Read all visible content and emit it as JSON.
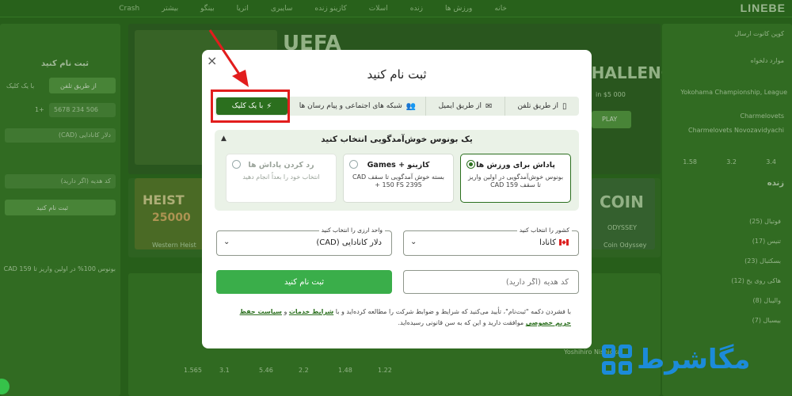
{
  "background": {
    "logo": "LINEBE",
    "topbar_items": [
      "خانه",
      "ورزش ها",
      "زنده",
      "اسلات",
      "کازینو زنده",
      "سایبری",
      "اتریا",
      "بینگو",
      "بیشتر",
      "Crash"
    ],
    "left_panel": {
      "header": "ثبت نام کنید",
      "tabs": [
        "از طریق تلفن",
        "با یک کلیک"
      ],
      "phone_prefix": "+1",
      "phone_placeholder": "506 234 5678",
      "currency": "دلار کانادایی (CAD)",
      "promo": "کد هدیه (اگر دارید)",
      "register": "ثبت نام کنید",
      "bonus_note": "بونوس 100% در اولین واریز تا 159 CAD"
    },
    "center": {
      "banner_text": "UEFA",
      "promo_text": "CHALLENGE",
      "promo_amount": "in $5 000",
      "play": "PLAY",
      "game1": "HEIST",
      "game1_amount": "25000",
      "game1_provider": "Western Heist",
      "game2": "COIN",
      "game2_sub": "ODYSSEY",
      "game2_provider": "Coin Odyssey"
    },
    "right_panel": {
      "header": "کوپن کانوت ارسال",
      "favorites": "موارد دلخواه",
      "match": "Yokohama Championship, League",
      "teams": [
        "Charmelovets",
        "Charmelovets Novozavidyachi"
      ],
      "live": "زنده",
      "odds": [
        "1.58",
        "3.2",
        "3.4"
      ],
      "sports": [
        "فوتبال (25)",
        "تنیس (17)",
        "بسکتبال (23)",
        "هاکی روی یخ (12)",
        "والیبال (8)",
        "بیسبال (7)"
      ]
    },
    "table_odds": [
      "1.565",
      "3.1",
      "5.46",
      "2.2",
      "1.48",
      "1.22"
    ],
    "table_team": "Yoshihiro Nishioka"
  },
  "modal": {
    "close": "×",
    "title": "ثبت نام کنید",
    "tabs": [
      {
        "label": "از طریق تلفن",
        "icon": "phone-icon",
        "glyph": "▯"
      },
      {
        "label": "از طریق ایمیل",
        "icon": "envelope-icon",
        "glyph": "✉"
      },
      {
        "label": "شبکه های اجتماعی و پیام رسان ها",
        "icon": "users-icon",
        "glyph": "👥"
      },
      {
        "label": "با یک کلیک",
        "icon": "lightning-icon",
        "glyph": "⚡",
        "active": true
      }
    ],
    "bonus": {
      "heading": "یک بونوس خوش‌آمدگویی انتخاب کنید",
      "options": [
        {
          "title": "پاداش برای ورزش ها",
          "desc": "بونوس خوش‌آمدگویی در اولین واریز تا سقف 159 CAD",
          "selected": true
        },
        {
          "title": "کازینو + Games",
          "desc": "بسته خوش آمدگویی تا سقف CAD + 150 FS 2395",
          "selected": false
        },
        {
          "title": "رد کردن پاداش ها",
          "desc": "انتخاب خود را بعداً انجام دهید",
          "selected": false
        }
      ]
    },
    "country": {
      "label": "کشور را انتخاب کنید",
      "value": "کانادا"
    },
    "currency": {
      "label": "واحد ارزی را انتخاب کنید",
      "value": "دلار کانادایی (CAD)"
    },
    "promo_placeholder": "کد هدیه (اگر دارید)",
    "submit": "ثبت نام کنید",
    "legal": {
      "before": "با فشردن دکمه \"ثبت‌نام\"، تأیید می‌کنید که شرایط و ضوابط شرکت را مطالعه کرده‌اید و با ",
      "link_terms": "شرایط خدمات",
      "middle": " و ",
      "link_privacy": "سیاست حفظ حریم خصوصی",
      "after": " موافقت دارید و این که به سن قانونی رسیده‌اید."
    }
  },
  "watermark": {
    "text": "مگاشرط"
  },
  "colors": {
    "brand_green": "#2b6f1e",
    "submit_green": "#3aae4a",
    "highlight_red": "#e21d1d",
    "watermark_blue": "#1c8bd9"
  }
}
